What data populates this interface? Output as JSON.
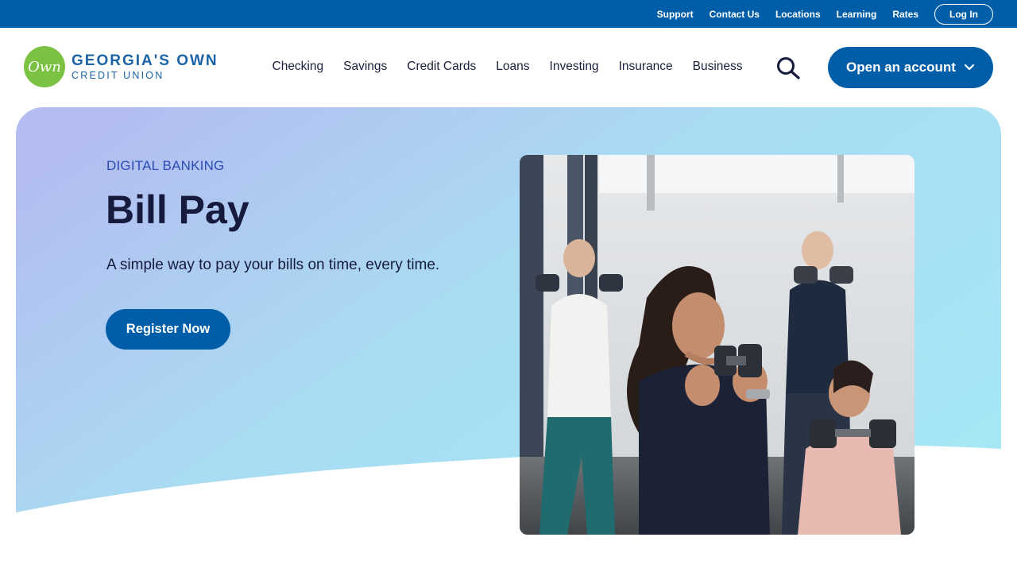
{
  "utility_nav": {
    "links": [
      "Support",
      "Contact Us",
      "Locations",
      "Learning",
      "Rates"
    ],
    "login_label": "Log In"
  },
  "logo": {
    "mark_text": "Own",
    "line1": "GEORGIA'S OWN",
    "line2": "CREDIT UNION"
  },
  "main_nav": {
    "items": [
      "Checking",
      "Savings",
      "Credit Cards",
      "Loans",
      "Investing",
      "Insurance",
      "Business"
    ],
    "search_icon": "search-icon",
    "open_account_label": "Open an account",
    "open_account_icon": "chevron-down-icon"
  },
  "hero": {
    "eyebrow": "DIGITAL BANKING",
    "title": "Bill Pay",
    "subtitle": "A simple way to pay your bills on time, every time.",
    "cta_label": "Register Now"
  },
  "colors": {
    "brand_blue": "#005ea8",
    "logo_green": "#7cc242",
    "hero_gradient_start": "#b3bdf0",
    "hero_gradient_end": "#a6e6f5",
    "text_dark": "#161a3d",
    "eyebrow_blue": "#2c4bb3"
  }
}
